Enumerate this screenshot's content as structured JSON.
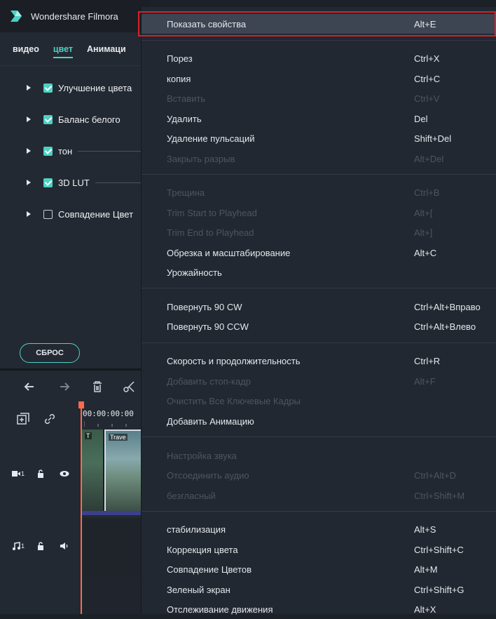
{
  "app": {
    "title": "Wondershare Filmora",
    "tabs": [
      "видео",
      "цвет",
      "Анимаци"
    ],
    "active_tab": "цвет",
    "accent_color": "#4cd2c4",
    "properties": [
      {
        "label": "Улучшение цвета",
        "checked": true
      },
      {
        "label": "Баланс белого",
        "checked": true
      },
      {
        "label": "тон",
        "checked": true
      },
      {
        "label": "3D LUT",
        "checked": true
      },
      {
        "label": "Совпадение Цвет",
        "checked": false
      }
    ],
    "reset_label": "СБРОС",
    "timecode": "00:00:00:00",
    "clip_label": "Trave",
    "clip_label_short": "T",
    "video_track_label": "1",
    "audio_track_label": "1"
  },
  "menu": {
    "highlight_color": "#d8202a",
    "items": [
      {
        "label": "Показать свойства",
        "shortcut": "Alt+E",
        "enabled": true,
        "highlighted": true
      },
      {
        "label": "Порез",
        "shortcut": "Ctrl+X",
        "enabled": true
      },
      {
        "label": "копия",
        "shortcut": "Ctrl+C",
        "enabled": true
      },
      {
        "label": "Вставить",
        "shortcut": "Ctrl+V",
        "enabled": false
      },
      {
        "label": "Удалить",
        "shortcut": "Del",
        "enabled": true
      },
      {
        "label": "Удаление пульсаций",
        "shortcut": "Shift+Del",
        "enabled": true
      },
      {
        "label": "Закрыть разрыв",
        "shortcut": "Alt+Del",
        "enabled": false
      },
      {
        "label": "Трещина",
        "shortcut": "Ctrl+B",
        "enabled": false
      },
      {
        "label": "Trim Start to Playhead",
        "shortcut": "Alt+[",
        "enabled": false
      },
      {
        "label": "Trim End to Playhead",
        "shortcut": "Alt+]",
        "enabled": false
      },
      {
        "label": "Обрезка и масштабирование",
        "shortcut": "Alt+C",
        "enabled": true
      },
      {
        "label": "Урожайность",
        "shortcut": "",
        "enabled": true
      },
      {
        "label": "Повернуть 90 CW",
        "shortcut": "Ctrl+Alt+Вправо",
        "enabled": true
      },
      {
        "label": "Повернуть 90 CCW",
        "shortcut": "Ctrl+Alt+Влево",
        "enabled": true
      },
      {
        "label": "Скорость и продолжительность",
        "shortcut": "Ctrl+R",
        "enabled": true
      },
      {
        "label": "Добавить стоп-кадр",
        "shortcut": "Alt+F",
        "enabled": false
      },
      {
        "label": "Очистить Все Ключевые Кадры",
        "shortcut": "",
        "enabled": false
      },
      {
        "label": "Добавить Анимацию",
        "shortcut": "",
        "enabled": true
      },
      {
        "label": "Настройка звука",
        "shortcut": "",
        "enabled": false
      },
      {
        "label": "Отсоединить аудио",
        "shortcut": "Ctrl+Alt+D",
        "enabled": false
      },
      {
        "label": "безгласный",
        "shortcut": "Ctrl+Shift+M",
        "enabled": false
      },
      {
        "label": "стабилизация",
        "shortcut": "Alt+S",
        "enabled": true
      },
      {
        "label": "Коррекция цвета",
        "shortcut": "Ctrl+Shift+C",
        "enabled": true
      },
      {
        "label": "Совпадение Цветов",
        "shortcut": "Alt+M",
        "enabled": true
      },
      {
        "label": "Зеленый экран",
        "shortcut": "Ctrl+Shift+G",
        "enabled": true
      },
      {
        "label": "Отслеживание движения",
        "shortcut": "Alt+X",
        "enabled": true
      }
    ]
  }
}
